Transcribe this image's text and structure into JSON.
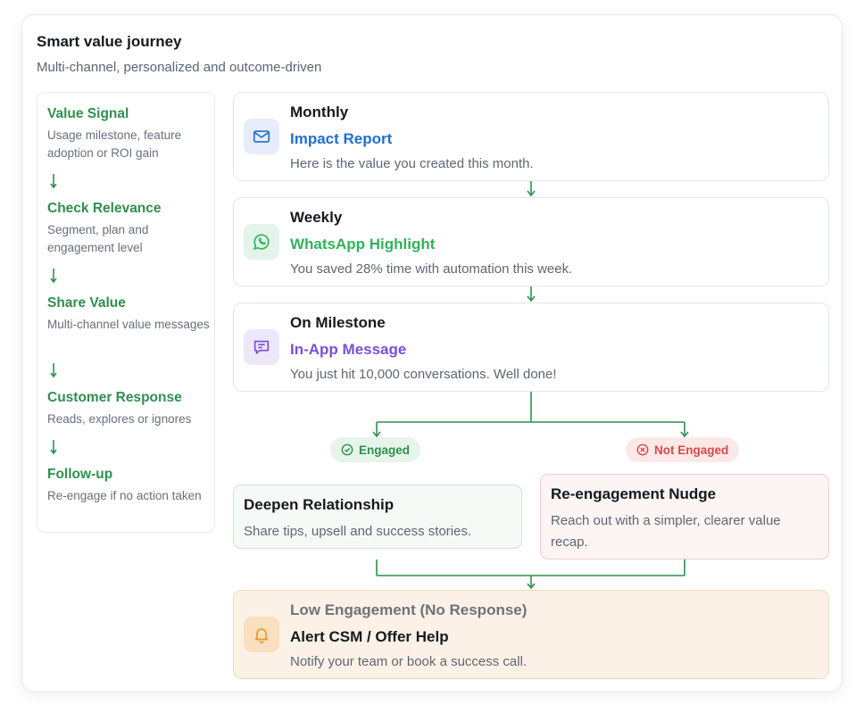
{
  "header": {
    "title": "Smart value journey",
    "subtitle": "Multi-channel, personalized and outcome-driven"
  },
  "steps": [
    {
      "title": "Value Signal",
      "desc": "Usage milestone, feature adoption or ROI gain"
    },
    {
      "title": "Check Relevance",
      "desc": "Segment, plan and engagement level"
    },
    {
      "title": "Share Value",
      "desc": "Multi-channel value messages"
    },
    {
      "title": "Customer Response",
      "desc": "Reads, explores or ignores"
    },
    {
      "title": "Follow-up",
      "desc": "Re-engage if no action taken"
    }
  ],
  "flow": [
    {
      "category": "Monthly",
      "channel": "Impact Report",
      "message": "Here is the value you created this month.",
      "icon": "mail-icon",
      "accent": "#1f6fd1",
      "icon_bg": "#e6ecf9"
    },
    {
      "category": "Weekly",
      "channel": "WhatsApp Highlight",
      "message": "You saved 28% time with automation this week.",
      "icon": "whatsapp-icon",
      "accent": "#2fb35a",
      "icon_bg": "#e5f4ea"
    },
    {
      "category": "On Milestone",
      "channel": "In-App Message",
      "message": "You just hit 10,000 conversations. Well done!",
      "icon": "chat-message-icon",
      "accent": "#7a4fd8",
      "icon_bg": "#ede7fa"
    }
  ],
  "branches": {
    "engaged_label": "Engaged",
    "not_engaged_label": "Not Engaged"
  },
  "outcomes": {
    "deepen": {
      "title": "Deepen Relationship",
      "desc": "Share tips, upsell and success stories."
    },
    "reengage": {
      "title": "Re-engagement Nudge",
      "desc": "Reach out with a simpler, clearer value recap."
    }
  },
  "final": {
    "category": "Low Engagement (No Response)",
    "action": "Alert CSM / Offer Help",
    "desc": "Notify your team or book a success call.",
    "icon": "bell-icon"
  },
  "colors": {
    "green": "#2f8f4e",
    "connector": "#2f8f4e",
    "red": "#d94848",
    "amber": "#e59a2b"
  }
}
